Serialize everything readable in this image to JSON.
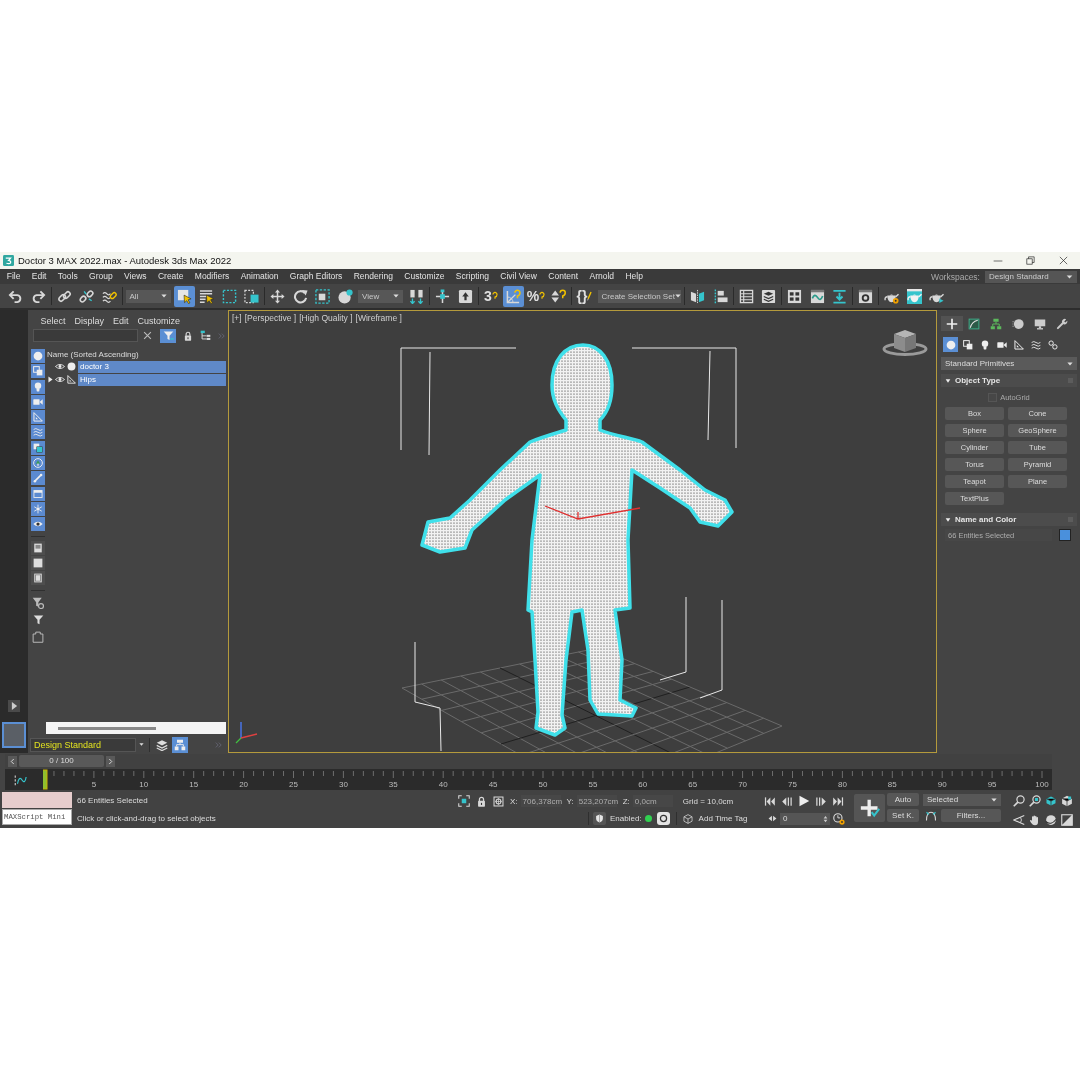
{
  "window": {
    "title": "Doctor 3 MAX 2022.max - Autodesk 3ds Max 2022"
  },
  "menu_bar": {
    "items": [
      "File",
      "Edit",
      "Tools",
      "Group",
      "Views",
      "Create",
      "Modifiers",
      "Animation",
      "Graph Editors",
      "Rendering",
      "Customize",
      "Scripting",
      "Civil View",
      "Content",
      "Arnold",
      "Help"
    ],
    "workspaces_label": "Workspaces:",
    "workspace": "Design Standard"
  },
  "main_toolbar": {
    "selection_filter": "All",
    "reference_coordinate_system": "View",
    "named_selection_set": "Create Selection Set",
    "buttons": [
      {
        "selected": false
      },
      {
        "selected": false
      },
      {
        "selected": false
      },
      {
        "selected": false
      },
      {
        "selected": false
      },
      {
        "selected": true
      },
      {
        "selected": false
      },
      {
        "selected": false
      },
      {
        "selected": false
      },
      {
        "selected": false
      },
      {
        "selected": false
      },
      {
        "selected": false
      },
      {
        "selected": false
      },
      {
        "selected": false
      },
      {
        "selected": false
      },
      {
        "selected": false
      },
      {
        "label": "3",
        "selected": false
      },
      {
        "selected": true
      },
      {
        "label": "%",
        "selected": false
      },
      {
        "selected": false
      },
      {
        "label": "{}",
        "selected": false
      },
      {
        "selected": false
      },
      {
        "selected": false
      },
      {
        "selected": false
      },
      {
        "selected": false
      },
      {
        "selected": false
      },
      {
        "selected": false
      },
      {
        "selected": false
      },
      {
        "selected": false
      },
      {
        "selected": false
      },
      {
        "selected": false
      },
      {
        "selected": false
      }
    ]
  },
  "scene_explorer": {
    "menu": [
      "Select",
      "Display",
      "Edit",
      "Customize"
    ],
    "filter_selected": true,
    "type_filters": [
      {
        "on": true
      },
      {
        "on": true
      },
      {
        "on": true
      },
      {
        "on": true
      },
      {
        "on": true
      },
      {
        "on": true
      },
      {
        "on": true
      },
      {
        "on": true
      },
      {
        "on": true
      },
      {
        "on": true
      },
      {
        "on": true
      },
      {
        "on": true
      }
    ],
    "column_header": "Name (Sorted Ascending)",
    "rows": [
      {
        "name": "doctor 3",
        "kind": "geometry",
        "selected": true
      },
      {
        "name": "Hips",
        "kind": "bone",
        "selected": true,
        "expanded": false
      }
    ],
    "layer": "Design Standard",
    "explorer_buttons": [
      {
        "selected": false
      },
      {
        "selected": true
      }
    ]
  },
  "viewport": {
    "labels": [
      "[+]",
      "[Perspective ]",
      "[High Quality ]",
      "[Wireframe ]"
    ],
    "active": true
  },
  "command_panel": {
    "tabs": [
      {
        "selected": true
      },
      {
        "selected": false
      },
      {
        "selected": false
      },
      {
        "selected": false
      },
      {
        "selected": false
      },
      {
        "selected": false
      }
    ],
    "categories": [
      {
        "selected": true
      },
      {
        "selected": false
      },
      {
        "selected": false
      },
      {
        "selected": false
      },
      {
        "selected": false
      },
      {
        "selected": false
      },
      {
        "selected": false
      }
    ],
    "category_dropdown": "Standard Primitives",
    "object_type": {
      "title": "Object Type",
      "expanded": true,
      "autogrid": {
        "label": "AutoGrid",
        "checked": false,
        "disabled": true
      },
      "buttons": [
        "Box",
        "Cone",
        "Sphere",
        "GeoSphere",
        "Cylinder",
        "Tube",
        "Torus",
        "Pyramid",
        "Teapot",
        "Plane",
        "TextPlus"
      ]
    },
    "name_and_color": {
      "title": "Name and Color",
      "expanded": true,
      "name": "66 Entities Selected",
      "disabled": true,
      "color": "#4a90dc"
    }
  },
  "time_slider": {
    "label": "0 / 100",
    "level": 0
  },
  "track_bar": {
    "labels": [
      "5",
      "10",
      "15",
      "20",
      "25",
      "30",
      "35",
      "40",
      "45",
      "50",
      "55",
      "60",
      "65",
      "70",
      "75",
      "80",
      "85",
      "90",
      "95",
      "100"
    ]
  },
  "status_bar": {
    "maxscript_placeholder": "MAXScript Mini",
    "selection": "66 Entities Selected",
    "prompt": "Click or click-and-drag to select objects",
    "coordinates": [
      {
        "axis": "X:",
        "value": "706,378cm",
        "disabled": true
      },
      {
        "axis": "Y:",
        "value": "523,207cm",
        "disabled": true
      },
      {
        "axis": "Z:",
        "value": "0,0cm",
        "disabled": true
      }
    ],
    "grid": "Grid = 10,0cm",
    "degradation_label": "Enabled:",
    "degradation_on": true,
    "time_tag": "Add Time Tag"
  },
  "animation_controls": {
    "current_frame": "0",
    "auto_key": "Auto",
    "set_key": "Set K.",
    "key_filter": "Selected",
    "filters": "Filters..."
  }
}
